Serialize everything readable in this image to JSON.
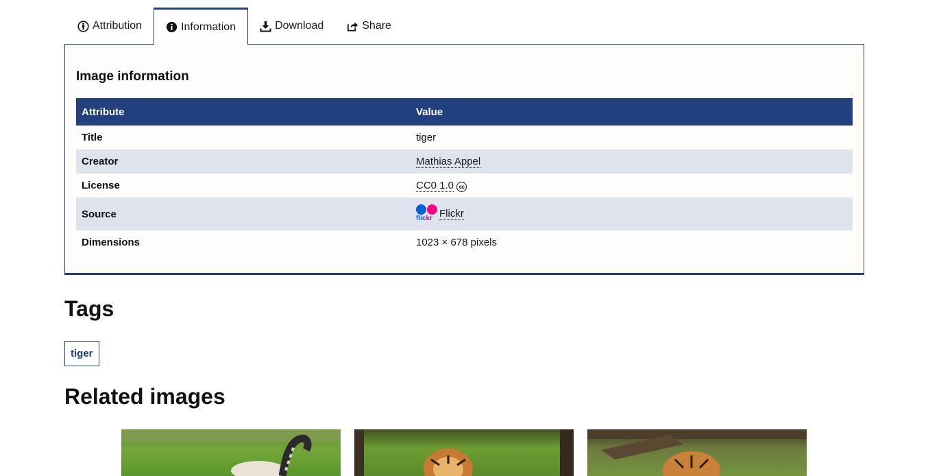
{
  "tabs": [
    {
      "label": "Attribution",
      "icon": "attribution-icon",
      "active": false
    },
    {
      "label": "Information",
      "icon": "info-icon",
      "active": true
    },
    {
      "label": "Download",
      "icon": "download-icon",
      "active": false
    },
    {
      "label": "Share",
      "icon": "share-icon",
      "active": false
    }
  ],
  "info_panel": {
    "heading": "Image information",
    "columns": [
      "Attribute",
      "Value"
    ],
    "rows": {
      "title": {
        "attr": "Title",
        "value": "tiger"
      },
      "creator": {
        "attr": "Creator",
        "value": "Mathias Appel"
      },
      "license": {
        "attr": "License",
        "value": "CC0 1.0",
        "icon": "cc-icon"
      },
      "source": {
        "attr": "Source",
        "value": "Flickr",
        "logo_text": "flickr"
      },
      "dimensions": {
        "attr": "Dimensions",
        "value": "1023 × 678 pixels"
      }
    }
  },
  "tags_section": {
    "heading": "Tags",
    "tags": [
      "tiger"
    ]
  },
  "related_section": {
    "heading": "Related images",
    "thumbnails": [
      "tiger-thumbnail",
      "tiger-thumbnail",
      "tiger-thumbnail"
    ]
  },
  "colors": {
    "primary": "#23407e",
    "row_alt": "#dfe3ee",
    "flickr_blue": "#0063dc",
    "flickr_pink": "#ff0084"
  }
}
